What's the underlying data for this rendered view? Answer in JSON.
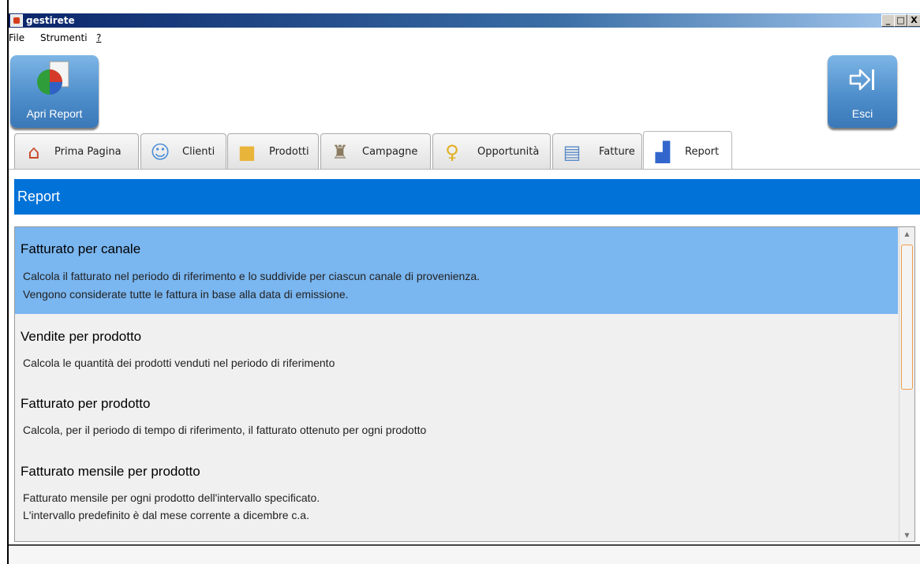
{
  "window": {
    "title": "gestirete",
    "buttons": {
      "minimize": "_",
      "maximize": "□",
      "close": "X"
    }
  },
  "menu": {
    "items": [
      "File",
      "Strumenti",
      "?"
    ]
  },
  "toolbar": {
    "open_report": "Apri Report",
    "exit": "Esci"
  },
  "tabs": [
    {
      "label": "Prima Pagina",
      "icon": "home-icon"
    },
    {
      "label": "Clienti",
      "icon": "users-icon"
    },
    {
      "label": "Prodotti",
      "icon": "box-icon"
    },
    {
      "label": "Campagne",
      "icon": "chess-piece-icon"
    },
    {
      "label": "Opportunità",
      "icon": "lightbulb-icon"
    },
    {
      "label": "Fatture",
      "icon": "document-icon"
    },
    {
      "label": "Report",
      "icon": "chart-icon"
    }
  ],
  "section": {
    "title": "Report"
  },
  "reports": [
    {
      "title": "Fatturato per canale",
      "desc": [
        "Calcola il fatturato nel periodo di riferimento e lo suddivide per ciascun canale di provenienza.",
        "Vengono considerate tutte le fattura in base alla data di emissione."
      ],
      "selected": true
    },
    {
      "title": "Vendite per prodotto",
      "desc": [
        "Calcola le quantità dei prodotti venduti nel periodo di riferimento"
      ],
      "selected": false
    },
    {
      "title": "Fatturato per prodotto",
      "desc": [
        "Calcola, per il periodo di tempo di riferimento, il fatturato ottenuto per ogni prodotto"
      ],
      "selected": false
    },
    {
      "title": "Fatturato mensile per prodotto",
      "desc": [
        "Fatturato mensile per ogni prodotto dell'intervallo specificato.",
        "L'intervallo predefinito è dal mese corrente a dicembre c.a."
      ],
      "selected": false
    }
  ],
  "colors": {
    "header": "#0072d8",
    "selected": "#7ab6f0",
    "button": "#4f8fcc"
  }
}
